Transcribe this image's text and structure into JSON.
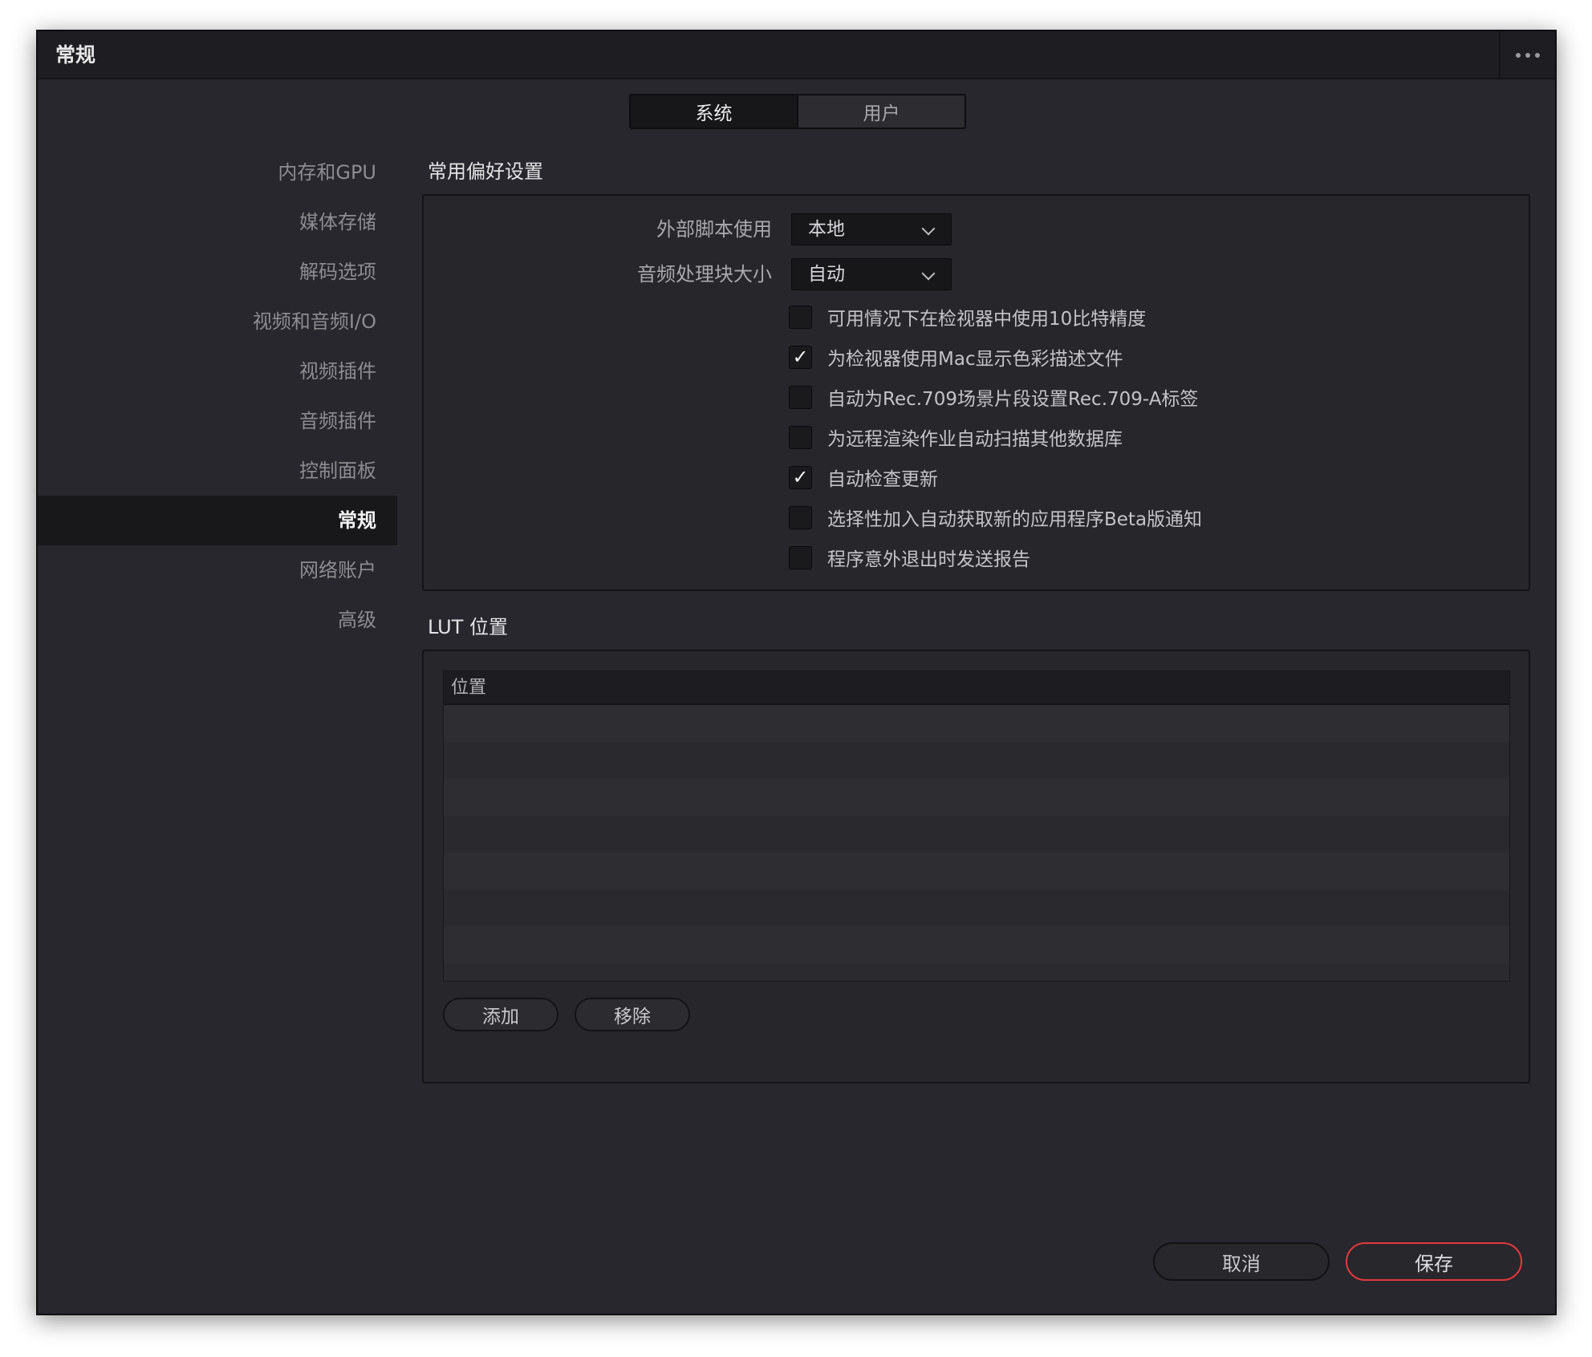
{
  "window": {
    "title": "常规"
  },
  "tabs": [
    {
      "label": "系统",
      "active": true
    },
    {
      "label": "用户",
      "active": false
    }
  ],
  "sidebar": {
    "items": [
      {
        "label": "内存和GPU"
      },
      {
        "label": "媒体存储"
      },
      {
        "label": "解码选项"
      },
      {
        "label": "视频和音频I/O"
      },
      {
        "label": "视频插件"
      },
      {
        "label": "音频插件"
      },
      {
        "label": "控制面板"
      },
      {
        "label": "常规",
        "active": true
      },
      {
        "label": "网络账户"
      },
      {
        "label": "高级"
      }
    ]
  },
  "general_prefs": {
    "title": "常用偏好设置",
    "external_scripting": {
      "label": "外部脚本使用",
      "value": "本地"
    },
    "audio_block_size": {
      "label": "音频处理块大小",
      "value": "自动"
    },
    "options": [
      {
        "label": "可用情况下在检视器中使用10比特精度",
        "checked": false
      },
      {
        "label": "为检视器使用Mac显示色彩描述文件",
        "checked": true
      },
      {
        "label": "自动为Rec.709场景片段设置Rec.709-A标签",
        "checked": false
      },
      {
        "label": "为远程渲染作业自动扫描其他数据库",
        "checked": false
      },
      {
        "label": "自动检查更新",
        "checked": true
      },
      {
        "label": "选择性加入自动获取新的应用程序Beta版通知",
        "checked": false
      },
      {
        "label": "程序意外退出时发送报告",
        "checked": false
      }
    ]
  },
  "lut": {
    "title": "LUT 位置",
    "column_header": "位置",
    "rows": [],
    "add_label": "添加",
    "remove_label": "移除"
  },
  "footer": {
    "cancel_label": "取消",
    "save_label": "保存"
  },
  "colors": {
    "background": "#27272d",
    "titlebar": "#1e1e22",
    "save_accent": "#e0393b"
  },
  "icons": {
    "more": "more-horizontal-icon",
    "dropdown": "chevron-down-icon",
    "check": "checkmark-icon"
  }
}
